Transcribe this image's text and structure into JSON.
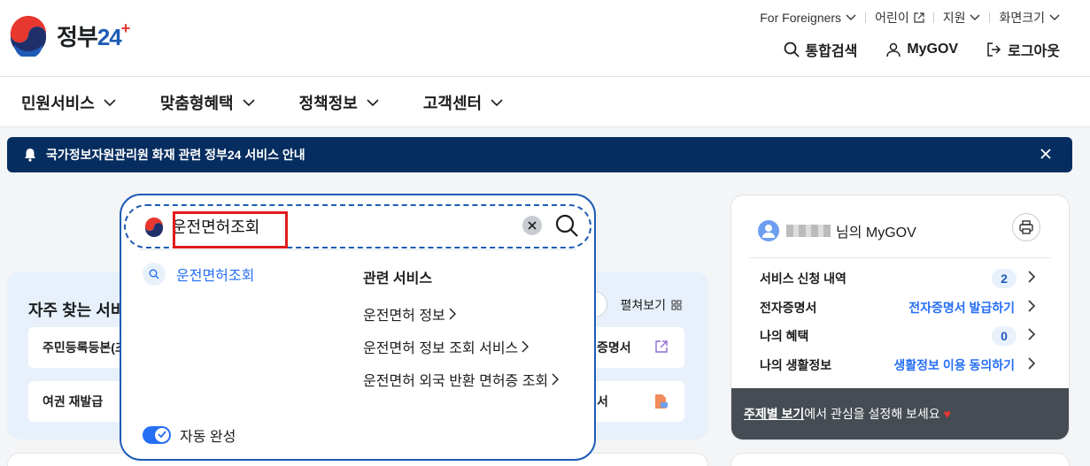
{
  "logo": {
    "text": "정부",
    "number": "24"
  },
  "util_nav": [
    {
      "label": "For Foreigners"
    },
    {
      "label": "어린이"
    },
    {
      "label": "지원"
    },
    {
      "label": "화면크기"
    }
  ],
  "gnb": {
    "search": "통합검색",
    "mygov": "MyGOV",
    "logout": "로그아웃"
  },
  "menu": [
    "민원서비스",
    "맞춤형혜택",
    "정책정보",
    "고객센터"
  ],
  "notice": {
    "text": "국가정보자원관리원 화재 관련 정부24 서비스 안내"
  },
  "frequent": {
    "title": "자주 찾는 서비",
    "expand_label": "펼쳐보기",
    "items": [
      {
        "left": "주민등록등본(초",
        "right": "증명서"
      },
      {
        "left": "여권 재발급",
        "right": "서"
      }
    ]
  },
  "mygov": {
    "suffix": "님의 MyGOV",
    "rows": [
      {
        "label": "서비스 신청 내역",
        "badge": "2"
      },
      {
        "label": "전자증명서",
        "link": "전자증명서 발급하기"
      },
      {
        "label": "나의 혜택",
        "badge": "0"
      },
      {
        "label": "나의 생활정보",
        "link": "생활정보 이용 동의하기"
      }
    ],
    "bottom_link": "주제별 보기",
    "bottom_text": "에서 관심을 설정해 보세요"
  },
  "search": {
    "query": "운전면허조회",
    "suggestion": "운전면허조회",
    "related_title": "관련 서비스",
    "related": [
      "운전면허 정보",
      "운전면허 정보 조회 서비스",
      "운전면허 외국 반환 면허증 조회"
    ],
    "autocomplete_label": "자동 완성"
  },
  "colors": {
    "primary": "#1e5bb5",
    "accent": "#256ef4",
    "notice_bg": "#062d5f",
    "highlight": "#e01b1b"
  }
}
